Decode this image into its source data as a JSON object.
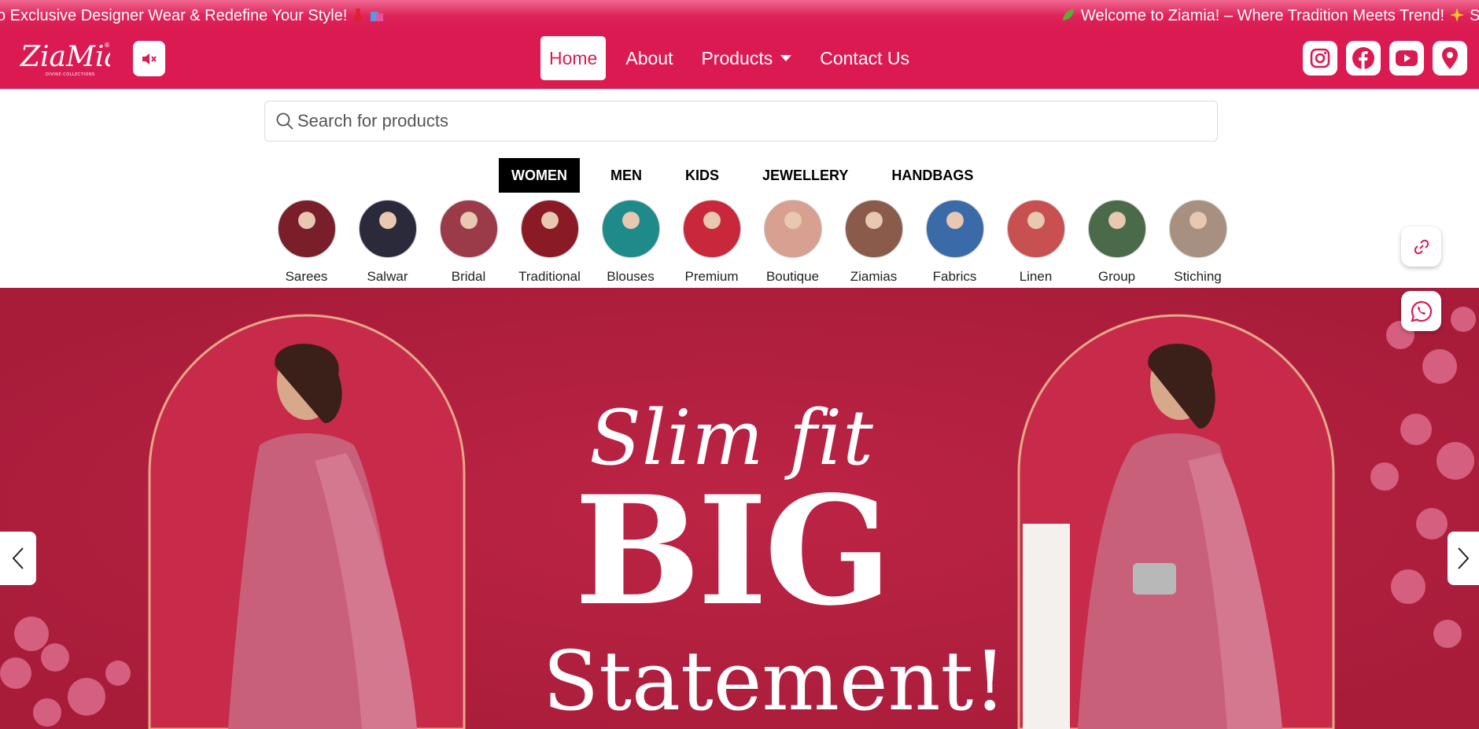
{
  "marquee": {
    "text_left": "o Exclusive Designer Wear & Redefine Your Style!",
    "text_right": "Welcome to Ziamia! – Where Tradition Meets Trend!",
    "text_right_tail": "Sho"
  },
  "brand": {
    "logo_text": "ZiaMia",
    "logo_subtext": "DIVINE COLLECTIONS",
    "primary_color": "#dc1a52",
    "hero_color": "#b0203f"
  },
  "nav": {
    "items": [
      {
        "label": "Home",
        "active": true
      },
      {
        "label": "About",
        "active": false
      },
      {
        "label": "Products",
        "active": false,
        "dropdown": true
      },
      {
        "label": "Contact Us",
        "active": false
      }
    ],
    "mute_icon": "volume-mute-icon",
    "social_icons": [
      "instagram-icon",
      "facebook-icon",
      "youtube-icon",
      "location-pin-icon"
    ]
  },
  "search": {
    "placeholder": "Search for products",
    "value": ""
  },
  "category_tabs": [
    {
      "label": "WOMEN",
      "active": true
    },
    {
      "label": "MEN",
      "active": false
    },
    {
      "label": "KIDS",
      "active": false
    },
    {
      "label": "JEWELLERY",
      "active": false
    },
    {
      "label": "HANDBAGS",
      "active": false
    }
  ],
  "subcategories": [
    {
      "label": "Sarees",
      "color": "#7a1e2a"
    },
    {
      "label": "Salwar",
      "color": "#2a2a3a"
    },
    {
      "label": "Bridal",
      "color": "#9b3a48"
    },
    {
      "label": "Traditional",
      "color": "#8a1a24"
    },
    {
      "label": "Blouses",
      "color": "#1f8a8a"
    },
    {
      "label": "Premium",
      "color": "#c8283a"
    },
    {
      "label": "Boutique",
      "color": "#d8a090"
    },
    {
      "label": "Ziamias",
      "color": "#8a5a4a"
    },
    {
      "label": "Fabrics",
      "color": "#3a6aa8"
    },
    {
      "label": "Linen",
      "color": "#c85050"
    },
    {
      "label": "Group",
      "color": "#4a6a4a"
    },
    {
      "label": "Stiching",
      "color": "#a89080"
    }
  ],
  "hero": {
    "line1": "Slim fit",
    "line2": "BIG",
    "line3": "Statement!"
  },
  "floating": {
    "link_icon": "link-icon",
    "whatsapp_icon": "whatsapp-icon"
  },
  "slider": {
    "prev_icon": "chevron-left-icon",
    "next_icon": "chevron-right-icon"
  }
}
